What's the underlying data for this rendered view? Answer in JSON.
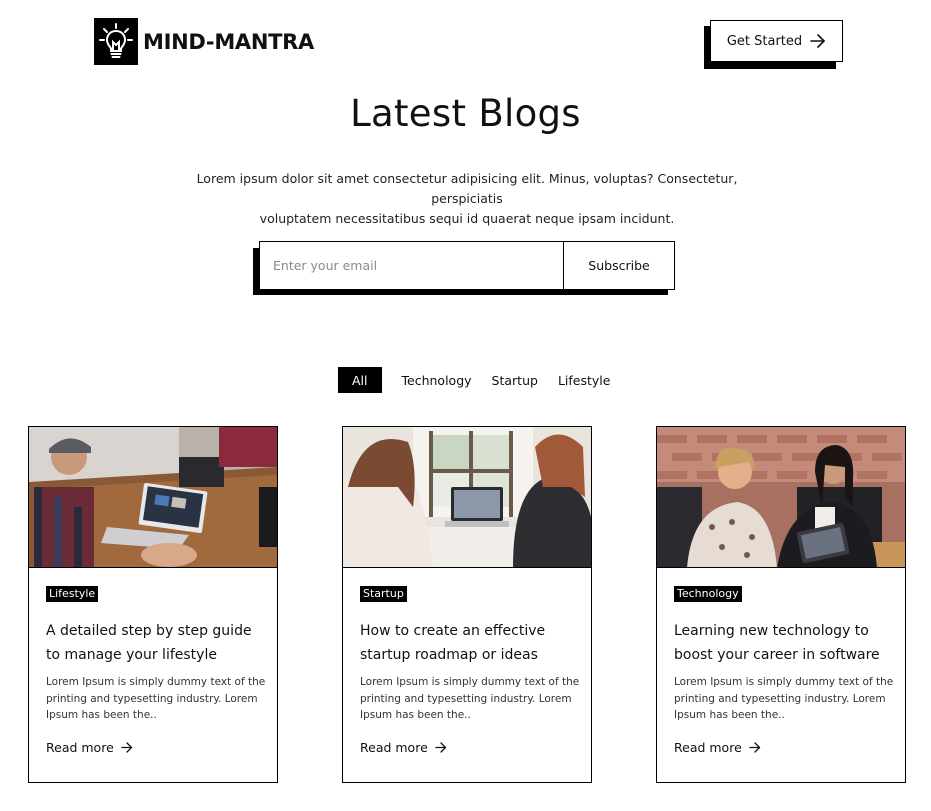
{
  "brand": {
    "name": "MIND-MANTRA",
    "logo_icon": "lightbulb-icon"
  },
  "header": {
    "cta_label": "Get Started",
    "cta_icon": "arrow-right-icon"
  },
  "hero": {
    "title": "Latest Blogs",
    "description_line1": "Lorem ipsum dolor sit amet consectetur adipisicing elit. Minus, voluptas? Consectetur, perspiciatis",
    "description_line2": "voluptatem necessitatibus sequi id quaerat neque ipsam incidunt."
  },
  "subscribe": {
    "placeholder": "Enter your email",
    "value": "",
    "button_label": "Subscribe"
  },
  "filters": [
    {
      "label": "All",
      "active": true
    },
    {
      "label": "Technology",
      "active": false
    },
    {
      "label": "Startup",
      "active": false
    },
    {
      "label": "Lifestyle",
      "active": false
    }
  ],
  "cards": [
    {
      "image": "people-with-laptops-at-table",
      "tag": "Lifestyle",
      "title": "A detailed step by step guide to manage your lifestyle",
      "excerpt": "Lorem Ipsum is simply dummy text of the printing and typesetting industry. Lorem Ipsum has been the..",
      "read_more": "Read more"
    },
    {
      "image": "two-women-at-laptop",
      "tag": "Startup",
      "title": "How to create an effective startup roadmap or ideas",
      "excerpt": "Lorem Ipsum is simply dummy text of the printing and typesetting industry. Lorem Ipsum has been the..",
      "read_more": "Read more"
    },
    {
      "image": "women-meeting-with-tablet",
      "tag": "Technology",
      "title": "Learning new technology to boost your career in software",
      "excerpt": "Lorem Ipsum is simply dummy text of the printing and typesetting industry. Lorem Ipsum has been the..",
      "read_more": "Read more"
    }
  ],
  "colors": {
    "primary": "#000000",
    "background": "#ffffff",
    "text": "#111111"
  }
}
